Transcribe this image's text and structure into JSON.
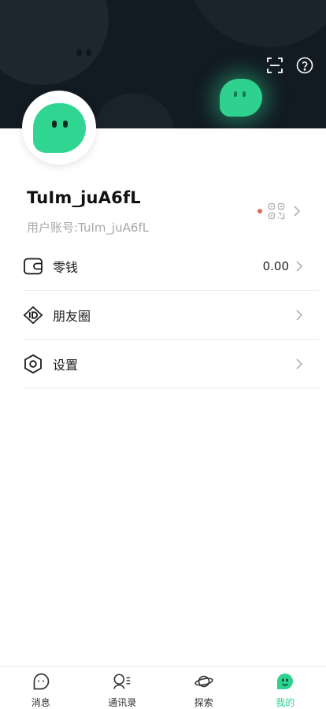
{
  "profile": {
    "username": "TuIm_juA6fL",
    "account_id": "用户账号:TuIm_juA6fL"
  },
  "menu": [
    {
      "label": "零钱",
      "value": "0.00",
      "icon": "wallet-icon"
    },
    {
      "label": "朋友圈",
      "value": "",
      "icon": "id-badge-icon"
    },
    {
      "label": "设置",
      "value": "",
      "icon": "settings-hexagon-icon"
    }
  ],
  "tabs": [
    {
      "label": "消息",
      "icon": "message-ghost-icon",
      "active": false
    },
    {
      "label": "通讯录",
      "icon": "contacts-icon",
      "active": false
    },
    {
      "label": "探索",
      "icon": "planet-icon",
      "active": false
    },
    {
      "label": "我的",
      "icon": "profile-ghost-icon",
      "active": true
    }
  ],
  "colors": {
    "accent": "#2fd18f",
    "banner_bg": "#121a22",
    "notification_dot": "#e2675f"
  }
}
